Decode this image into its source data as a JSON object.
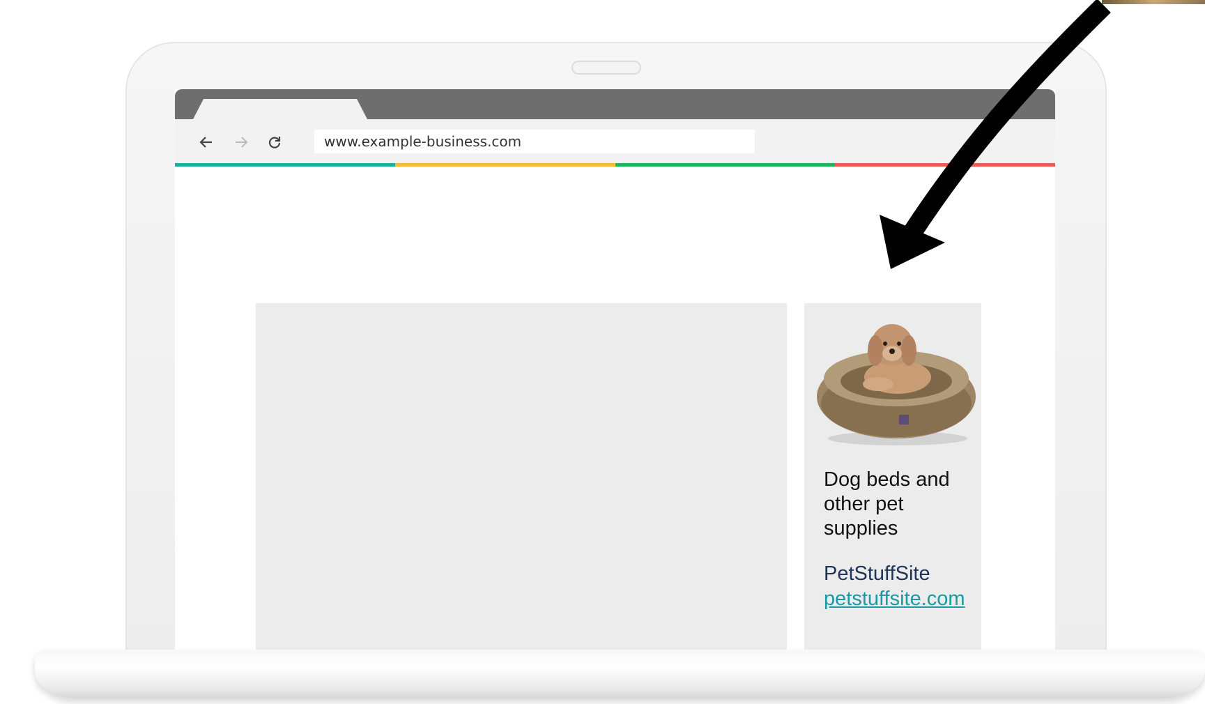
{
  "browser": {
    "url": "www.example-business.com",
    "accent_colors": [
      "#1aae9f",
      "#f6b93b",
      "#22b45a",
      "#ec5a5a"
    ],
    "back_icon": "arrow-left-icon",
    "forward_icon": "arrow-right-icon",
    "reload_icon": "reload-icon"
  },
  "ad": {
    "image_icon": "dog-bed-photo",
    "headline": "Dog beds and other pet supplies",
    "brand": "PetStuffSite",
    "url": "petstuffsite.com"
  },
  "annotation": {
    "arrow_color": "#000000"
  }
}
